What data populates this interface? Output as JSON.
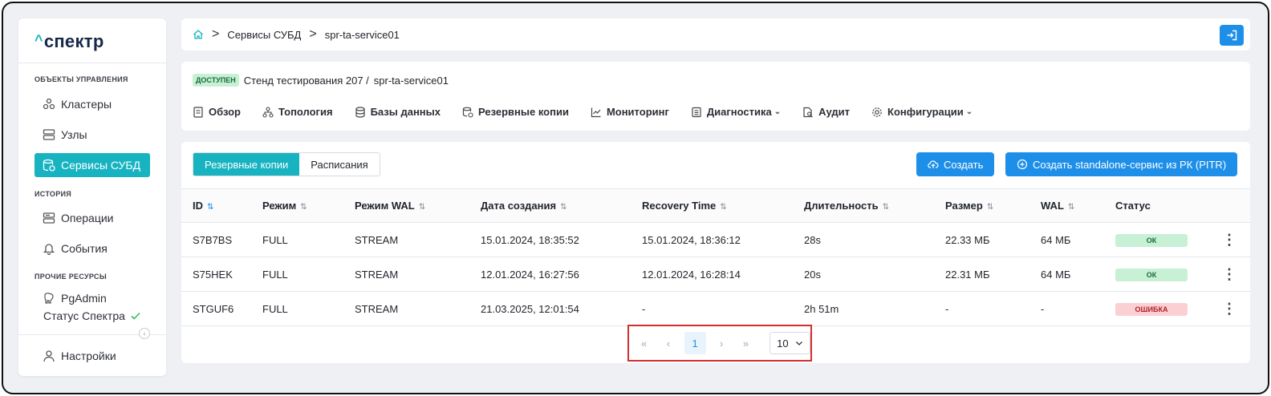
{
  "sidebar": {
    "logo_caret": "^",
    "logo": "спектр",
    "sections": {
      "objects": "ОБЪЕКТЫ УПРАВЛЕНИЯ",
      "history": "ИСТОРИЯ",
      "other": "ПРОЧИЕ РЕСУРСЫ"
    },
    "items": {
      "clusters": "Кластеры",
      "nodes": "Узлы",
      "db_services": "Сервисы СУБД",
      "operations": "Операции",
      "events": "События",
      "pgadmin": "PgAdmin",
      "status": "Статус Спектра",
      "settings": "Настройки"
    }
  },
  "breadcrumb": {
    "items": [
      "Сервисы СУБД",
      "spr-ta-service01"
    ],
    "separator": ">"
  },
  "service": {
    "status_badge": "ДОСТУПЕН",
    "stand": "Стенд тестирования 207 /",
    "name": "spr-ta-service01"
  },
  "tabs": {
    "overview": "Обзор",
    "topology": "Топология",
    "databases": "Базы данных",
    "backups": "Резервные копии",
    "monitoring": "Мониторинг",
    "diagnostics": "Диагностика",
    "audit": "Аудит",
    "configs": "Конфигурации"
  },
  "subtabs": {
    "backups": "Резервные копии",
    "schedules": "Расписания"
  },
  "actions": {
    "create": "Создать",
    "create_pitr": "Создать standalone-сервис из РК (PITR)"
  },
  "table": {
    "headers": {
      "id": "ID",
      "mode": "Режим",
      "wal_mode": "Режим WAL",
      "created": "Дата создания",
      "recovery": "Recovery Time",
      "duration": "Длительность",
      "size": "Размер",
      "wal": "WAL",
      "status": "Статус"
    },
    "rows": [
      {
        "id": "S7B7BS",
        "mode": "FULL",
        "wal_mode": "STREAM",
        "created": "15.01.2024, 18:35:52",
        "recovery": "15.01.2024, 18:36:12",
        "duration": "28s",
        "size": "22.33 МБ",
        "wal": "64 МБ",
        "status": "ОК"
      },
      {
        "id": "S75HEK",
        "mode": "FULL",
        "wal_mode": "STREAM",
        "created": "12.01.2024, 16:27:56",
        "recovery": "12.01.2024, 16:28:14",
        "duration": "20s",
        "size": "22.31 МБ",
        "wal": "64 МБ",
        "status": "ОК"
      },
      {
        "id": "STGUF6",
        "mode": "FULL",
        "wal_mode": "STREAM",
        "created": "21.03.2025, 12:01:54",
        "recovery": "-",
        "duration": "2h 51m",
        "size": "-",
        "wal": "-",
        "status": "ОШИБКА"
      }
    ]
  },
  "pagination": {
    "first": "«",
    "prev": "‹",
    "current": "1",
    "next": "›",
    "last": "»",
    "page_size": "10"
  },
  "colors": {
    "accent": "#17b3c1",
    "primary": "#1e8fe8",
    "ok": "#c7f0d4",
    "error": "#fbd0d3"
  }
}
